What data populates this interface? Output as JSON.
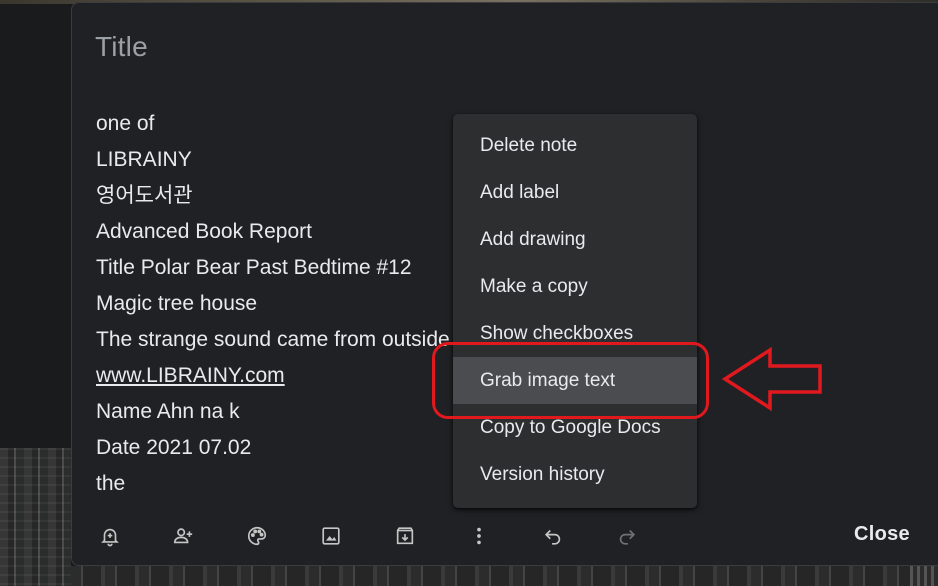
{
  "note": {
    "title_placeholder": "Title",
    "body_lines": [
      "one of",
      "LIBRAINY",
      "영어도서관",
      "Advanced Book Report",
      "Title Polar Bear Past Bedtime #12",
      "Magic tree house",
      "The strange sound came from outside",
      "www.LIBRAINY.com",
      "Name Ahn na k",
      "Date 2021 07.02",
      "the"
    ]
  },
  "toolbar": {
    "icons": [
      "bell-plus-icon",
      "person-add-icon",
      "palette-icon",
      "image-icon",
      "archive-icon",
      "more-vert-icon",
      "undo-icon",
      "redo-icon"
    ],
    "close_label": "Close"
  },
  "menu": {
    "items": [
      "Delete note",
      "Add label",
      "Add drawing",
      "Make a copy",
      "Show checkboxes",
      "Grab image text",
      "Copy to Google Docs",
      "Version history"
    ],
    "highlighted_item": "Grab image text"
  },
  "colors": {
    "note_bg": "#202124",
    "menu_bg": "#2d2e30",
    "menu_highlight": "#4b4c4f",
    "text": "#e8eaed",
    "annotation": "#e0191e"
  }
}
